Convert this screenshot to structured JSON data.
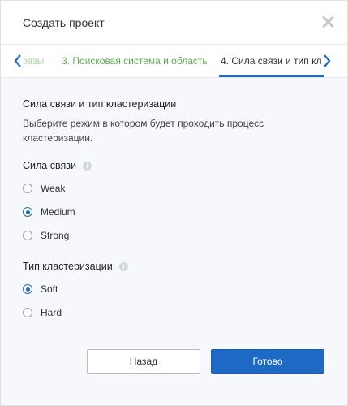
{
  "dialog": {
    "title": "Создать проект"
  },
  "tabs": [
    {
      "label": "разы"
    },
    {
      "label": "3. Поисковая система и область"
    },
    {
      "label": "4. Сила связи и тип кл"
    }
  ],
  "section": {
    "title": "Сила связи и тип кластеризации",
    "description_line1": "Выберите режим в котором будет проходить процесс",
    "description_line2": "кластеризации."
  },
  "strength": {
    "label": "Сила связи",
    "options": [
      "Weak",
      "Medium",
      "Strong"
    ],
    "selected": "Medium"
  },
  "clustering": {
    "label": "Тип кластеризации",
    "options": [
      "Soft",
      "Hard"
    ],
    "selected": "Soft"
  },
  "buttons": {
    "back": "Назад",
    "done": "Готово"
  },
  "colors": {
    "accent": "#1d69c3",
    "done_tab": "#5fb04f"
  }
}
